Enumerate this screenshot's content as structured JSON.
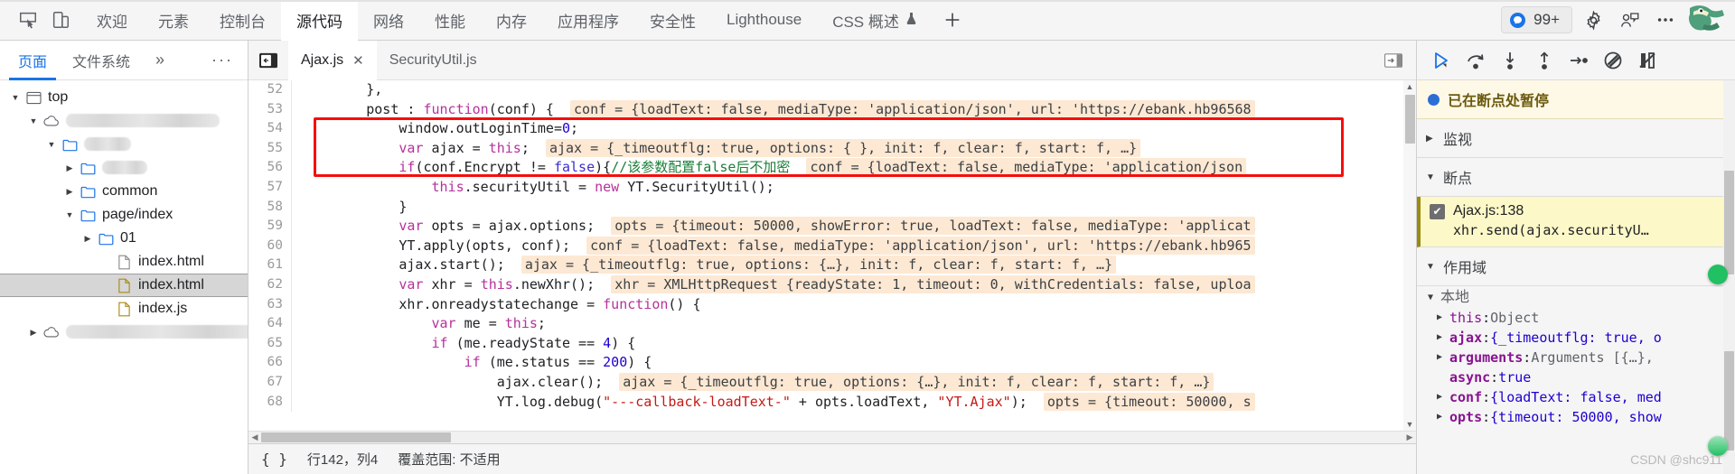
{
  "topbar": {
    "dock_icons": [
      "inspect-element-icon",
      "device-toolbar-icon"
    ],
    "tabs": [
      {
        "label": "欢迎",
        "active": false
      },
      {
        "label": "元素",
        "active": false
      },
      {
        "label": "控制台",
        "active": false
      },
      {
        "label": "源代码",
        "active": true
      },
      {
        "label": "网络",
        "active": false
      },
      {
        "label": "性能",
        "active": false
      },
      {
        "label": "内存",
        "active": false
      },
      {
        "label": "应用程序",
        "active": false
      },
      {
        "label": "安全性",
        "active": false
      },
      {
        "label": "Lighthouse",
        "active": false
      },
      {
        "label": "CSS 概述",
        "active": false,
        "flask": true
      }
    ],
    "add_tab_label": "+",
    "issues_count": "99+",
    "right_icons": [
      "settings-gear-icon",
      "feedback-icon",
      "more-options-icon"
    ]
  },
  "navigator": {
    "tabs": [
      {
        "label": "页面",
        "active": true
      },
      {
        "label": "文件系统",
        "active": false
      }
    ],
    "more_tabs_label": "»",
    "more_menu_label": "···",
    "tree": [
      {
        "depth": 0,
        "twisty": "open",
        "icon": "frame-icon",
        "label": "top",
        "redacted": 0,
        "selected": false
      },
      {
        "depth": 1,
        "twisty": "open",
        "icon": "cloud-icon",
        "label": "",
        "redacted": 170,
        "selected": false
      },
      {
        "depth": 2,
        "twisty": "open",
        "icon": "folder-icon",
        "label": "",
        "redacted": 52,
        "selected": false
      },
      {
        "depth": 3,
        "twisty": "closed",
        "icon": "folder-icon",
        "label": "",
        "redacted": 50,
        "selected": false
      },
      {
        "depth": 3,
        "twisty": "closed",
        "icon": "folder-icon",
        "label": "common",
        "redacted": 0,
        "selected": false
      },
      {
        "depth": 3,
        "twisty": "open",
        "icon": "folder-icon",
        "label": "page/index",
        "redacted": 0,
        "selected": false
      },
      {
        "depth": 4,
        "twisty": "closed",
        "icon": "folder-icon",
        "label": "01",
        "redacted": 0,
        "selected": false
      },
      {
        "depth": 5,
        "twisty": "none",
        "icon": "file-icon",
        "label": "index.html",
        "redacted": 0,
        "selected": false
      },
      {
        "depth": 5,
        "twisty": "none",
        "icon": "file-js-icon",
        "label": "index.html",
        "redacted": 0,
        "selected": true
      },
      {
        "depth": 5,
        "twisty": "none",
        "icon": "file-js-icon",
        "label": "index.js",
        "redacted": 0,
        "selected": false
      },
      {
        "depth": 1,
        "twisty": "closed",
        "icon": "cloud-icon",
        "label": "",
        "redacted": 210,
        "selected": false
      }
    ]
  },
  "editor": {
    "back_button": "collapse-sidebar-icon",
    "tabs": [
      {
        "label": "Ajax.js",
        "active": true,
        "closable": true
      },
      {
        "label": "SecurityUtil.js",
        "active": false,
        "closable": false
      }
    ],
    "collapse_button": "expand-panel-icon",
    "lines": [
      {
        "n": "52",
        "tokens": [
          {
            "t": "        },",
            "c": "pln"
          }
        ]
      },
      {
        "n": "53",
        "tokens": [
          {
            "t": "        post : ",
            "c": "pln"
          },
          {
            "t": "function",
            "c": "kw"
          },
          {
            "t": "(conf) {",
            "c": "pln"
          },
          {
            "t": "  ",
            "c": "pln"
          },
          {
            "t": "conf = {loadText: false, mediaType: 'application/json', url: 'https://ebank.hb96568",
            "c": "ev"
          }
        ]
      },
      {
        "n": "54",
        "tokens": [
          {
            "t": "            window.outLoginTime=",
            "c": "pln"
          },
          {
            "t": "0",
            "c": "num"
          },
          {
            "t": ";",
            "c": "pln"
          }
        ]
      },
      {
        "n": "55",
        "tokens": [
          {
            "t": "            ",
            "c": "pln"
          },
          {
            "t": "var",
            "c": "kw"
          },
          {
            "t": " ajax = ",
            "c": "pln"
          },
          {
            "t": "this",
            "c": "kw"
          },
          {
            "t": ";",
            "c": "pln"
          },
          {
            "t": "  ",
            "c": "pln"
          },
          {
            "t": "ajax = {_timeoutflg: true, options: { }, init: f, clear: f, start: f, …}",
            "c": "ev"
          }
        ]
      },
      {
        "n": "56",
        "tokens": [
          {
            "t": "            ",
            "c": "pln"
          },
          {
            "t": "if",
            "c": "kw"
          },
          {
            "t": "(conf.Encrypt != ",
            "c": "pln"
          },
          {
            "t": "false",
            "c": "kw2"
          },
          {
            "t": "){",
            "c": "pln"
          },
          {
            "t": "//该参数配置false后不加密",
            "c": "cmt"
          },
          {
            "t": "  ",
            "c": "pln"
          },
          {
            "t": "conf = {loadText: false, mediaType: 'application/json",
            "c": "ev"
          }
        ]
      },
      {
        "n": "57",
        "tokens": [
          {
            "t": "                ",
            "c": "pln"
          },
          {
            "t": "this",
            "c": "kw"
          },
          {
            "t": ".securityUtil = ",
            "c": "pln"
          },
          {
            "t": "new",
            "c": "kw"
          },
          {
            "t": " YT.SecurityUtil();",
            "c": "pln"
          }
        ]
      },
      {
        "n": "58",
        "tokens": [
          {
            "t": "            }",
            "c": "pln"
          }
        ]
      },
      {
        "n": "59",
        "tokens": [
          {
            "t": "            ",
            "c": "pln"
          },
          {
            "t": "var",
            "c": "kw"
          },
          {
            "t": " opts = ajax.options;",
            "c": "pln"
          },
          {
            "t": "  ",
            "c": "pln"
          },
          {
            "t": "opts = {timeout: 50000, showError: true, loadText: false, mediaType: 'applicat",
            "c": "ev"
          }
        ]
      },
      {
        "n": "60",
        "tokens": [
          {
            "t": "            YT.apply(opts, conf);",
            "c": "pln"
          },
          {
            "t": "  ",
            "c": "pln"
          },
          {
            "t": "conf = {loadText: false, mediaType: 'application/json', url: 'https://ebank.hb965",
            "c": "ev"
          }
        ]
      },
      {
        "n": "61",
        "tokens": [
          {
            "t": "            ajax.start();",
            "c": "pln"
          },
          {
            "t": "  ",
            "c": "pln"
          },
          {
            "t": "ajax = {_timeoutflg: true, options: {…}, init: f, clear: f, start: f, …}",
            "c": "ev"
          }
        ]
      },
      {
        "n": "62",
        "tokens": [
          {
            "t": "            ",
            "c": "pln"
          },
          {
            "t": "var",
            "c": "kw"
          },
          {
            "t": " xhr = ",
            "c": "pln"
          },
          {
            "t": "this",
            "c": "kw"
          },
          {
            "t": ".newXhr();",
            "c": "pln"
          },
          {
            "t": "  ",
            "c": "pln"
          },
          {
            "t": "xhr = XMLHttpRequest {readyState: 1, timeout: 0, withCredentials: false, uploa",
            "c": "ev"
          }
        ]
      },
      {
        "n": "63",
        "tokens": [
          {
            "t": "            xhr.onreadystatechange = ",
            "c": "pln"
          },
          {
            "t": "function",
            "c": "kw"
          },
          {
            "t": "() {",
            "c": "pln"
          }
        ]
      },
      {
        "n": "64",
        "tokens": [
          {
            "t": "                ",
            "c": "pln"
          },
          {
            "t": "var",
            "c": "kw"
          },
          {
            "t": " me = ",
            "c": "pln"
          },
          {
            "t": "this",
            "c": "kw"
          },
          {
            "t": ";",
            "c": "pln"
          }
        ]
      },
      {
        "n": "65",
        "tokens": [
          {
            "t": "                ",
            "c": "pln"
          },
          {
            "t": "if",
            "c": "kw"
          },
          {
            "t": " (me.readyState == ",
            "c": "pln"
          },
          {
            "t": "4",
            "c": "num"
          },
          {
            "t": ") {",
            "c": "pln"
          }
        ]
      },
      {
        "n": "66",
        "tokens": [
          {
            "t": "                    ",
            "c": "pln"
          },
          {
            "t": "if",
            "c": "kw"
          },
          {
            "t": " (me.status == ",
            "c": "pln"
          },
          {
            "t": "200",
            "c": "num"
          },
          {
            "t": ") {",
            "c": "pln"
          }
        ]
      },
      {
        "n": "67",
        "tokens": [
          {
            "t": "                        ajax.clear();",
            "c": "pln"
          },
          {
            "t": "  ",
            "c": "pln"
          },
          {
            "t": "ajax = {_timeoutflg: true, options: {…}, init: f, clear: f, start: f, …}",
            "c": "ev"
          }
        ]
      },
      {
        "n": "68",
        "tokens": [
          {
            "t": "                        YT.log.debug(",
            "c": "pln"
          },
          {
            "t": "\"---callback-loadText-\"",
            "c": "str"
          },
          {
            "t": " + opts.loadText, ",
            "c": "pln"
          },
          {
            "t": "\"YT.Ajax\"",
            "c": "str"
          },
          {
            "t": ");",
            "c": "pln"
          },
          {
            "t": "  ",
            "c": "pln"
          },
          {
            "t": "opts = {timeout: 50000, s",
            "c": "ev"
          }
        ]
      }
    ],
    "status": {
      "format_button": "{ }",
      "position": "行142，列4",
      "coverage": "覆盖范围: 不适用"
    }
  },
  "debugger": {
    "toolbar_buttons": [
      "resume-script-icon",
      "step-over-icon",
      "step-into-icon",
      "step-out-icon",
      "step-icon",
      "deactivate-breakpoints-icon",
      "pause-on-exceptions-icon"
    ],
    "paused_message": "已在断点处暂停",
    "sections": [
      {
        "label": "监视",
        "open": false
      },
      {
        "label": "断点",
        "open": true
      },
      {
        "label": "作用域",
        "open": true
      }
    ],
    "breakpoint": {
      "checked": true,
      "location": "Ajax.js:138",
      "snippet": "xhr.send(ajax.securityU…"
    },
    "scope": {
      "title": "本地",
      "vars": [
        {
          "twisty": "closed",
          "key": "this",
          "bold": false,
          "value": "Object",
          "vclass": "obj"
        },
        {
          "twisty": "closed",
          "key": "ajax",
          "bold": true,
          "value": "{_timeoutflg: true, o",
          "vclass": "val"
        },
        {
          "twisty": "closed",
          "key": "arguments",
          "bold": true,
          "value": "Arguments [{…}, ",
          "vclass": "obj"
        },
        {
          "twisty": "none",
          "key": "async",
          "bold": true,
          "value": "true",
          "vclass": "val"
        },
        {
          "twisty": "closed",
          "key": "conf",
          "bold": true,
          "value": "{loadText: false, med",
          "vclass": "val"
        },
        {
          "twisty": "closed",
          "key": "opts",
          "bold": true,
          "value": "{timeout: 50000, show",
          "vclass": "val"
        }
      ]
    },
    "watermark": "CSDN @shc911"
  },
  "colors": {
    "accent": "#1a73e8",
    "highlight_eval": "#fde8d3",
    "breakpoint_bg": "#fcf8c8",
    "paused_bg": "#fef9e6",
    "redbox": "#f60d0d",
    "selection": "#d6d6d6"
  }
}
